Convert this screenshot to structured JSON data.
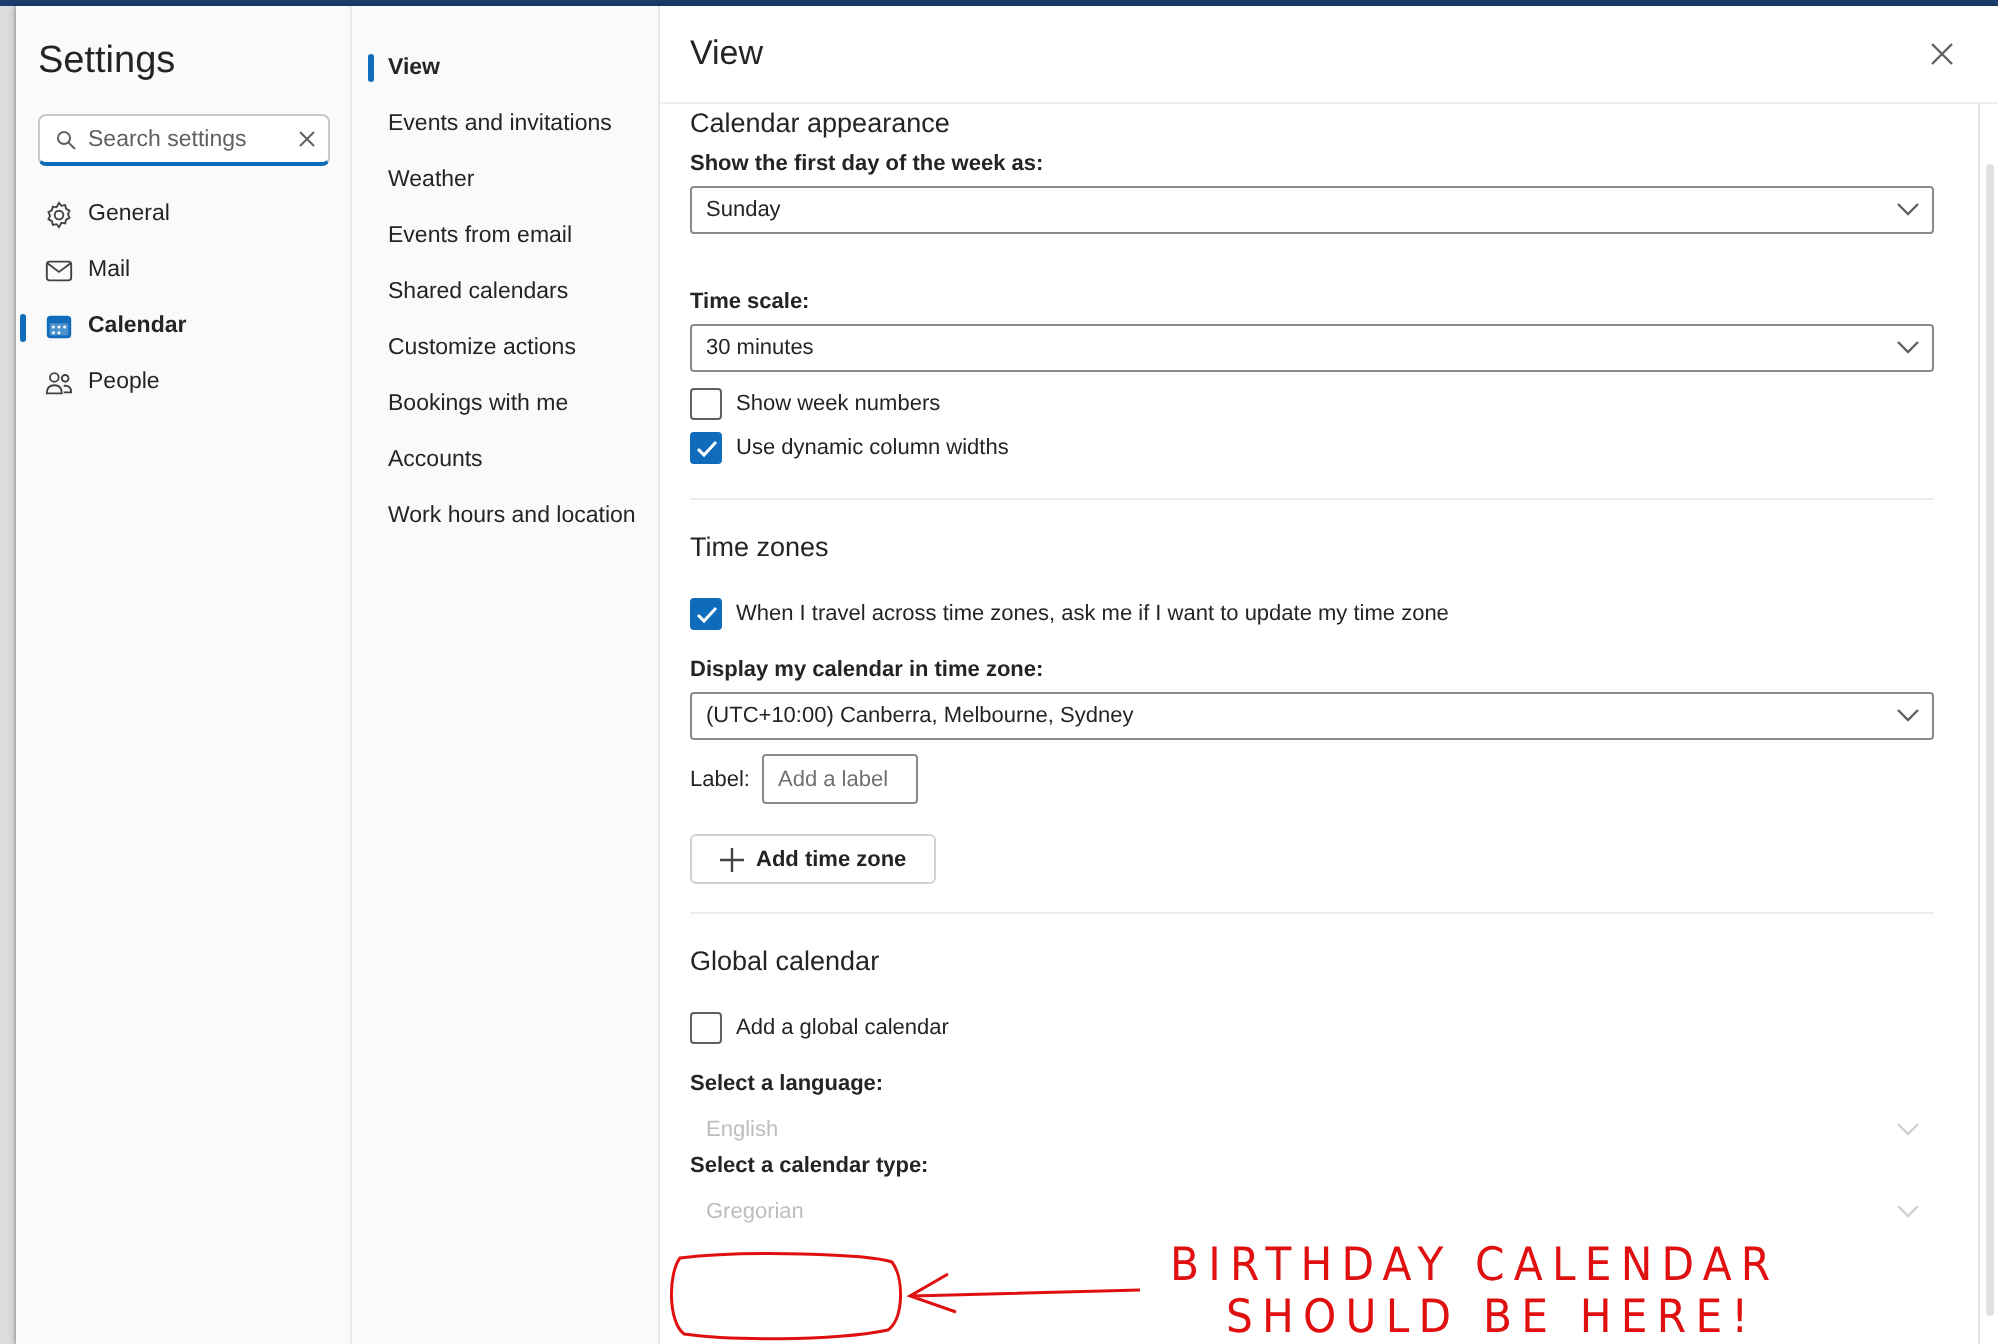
{
  "settings_title": "Settings",
  "search": {
    "placeholder": "Search settings"
  },
  "nav": [
    {
      "label": "General",
      "kind": "gear",
      "selected": false
    },
    {
      "label": "Mail",
      "kind": "mail",
      "selected": false
    },
    {
      "label": "Calendar",
      "kind": "calendar",
      "selected": true
    },
    {
      "label": "People",
      "kind": "people",
      "selected": false
    }
  ],
  "subnav": [
    {
      "label": "View",
      "selected": true
    },
    {
      "label": "Events and invitations",
      "selected": false
    },
    {
      "label": "Weather",
      "selected": false
    },
    {
      "label": "Events from email",
      "selected": false
    },
    {
      "label": "Shared calendars",
      "selected": false
    },
    {
      "label": "Customize actions",
      "selected": false
    },
    {
      "label": "Bookings with me",
      "selected": false
    },
    {
      "label": "Accounts",
      "selected": false
    },
    {
      "label": "Work hours and location",
      "selected": false
    }
  ],
  "panel": {
    "title": "View",
    "sections": [
      {
        "title": "Calendar appearance",
        "items": [
          {
            "kind": "select",
            "label": "Show the first day of the week as:",
            "value": "Sunday",
            "disabled": false
          },
          {
            "kind": "select",
            "label": "Time scale:",
            "value": "30 minutes",
            "disabled": false
          },
          {
            "kind": "checkbox",
            "label": "Show week numbers",
            "checked": false
          },
          {
            "kind": "checkbox",
            "label": "Use dynamic column widths",
            "checked": true
          }
        ]
      },
      {
        "title": "Time zones",
        "items": [
          {
            "kind": "checkbox",
            "label": "When I travel across time zones, ask me if I want to update my time zone",
            "checked": true
          },
          {
            "kind": "select",
            "label": "Display my calendar in time zone:",
            "value": "(UTC+10:00) Canberra, Melbourne, Sydney",
            "disabled": false
          },
          {
            "kind": "text_input",
            "label": "Label:",
            "placeholder": "Add a label"
          },
          {
            "kind": "button",
            "label": "Add time zone"
          }
        ]
      },
      {
        "title": "Global calendar",
        "items": [
          {
            "kind": "checkbox",
            "label": "Add a global calendar",
            "checked": false
          },
          {
            "kind": "select",
            "label": "Select a language:",
            "value": "English",
            "disabled": true
          },
          {
            "kind": "select",
            "label": "Select a calendar type:",
            "value": "Gregorian",
            "disabled": true
          }
        ]
      }
    ]
  },
  "annotation": {
    "lines": [
      "BIRTHDAY CALENDAR",
      "SHOULD BE HERE!"
    ]
  }
}
